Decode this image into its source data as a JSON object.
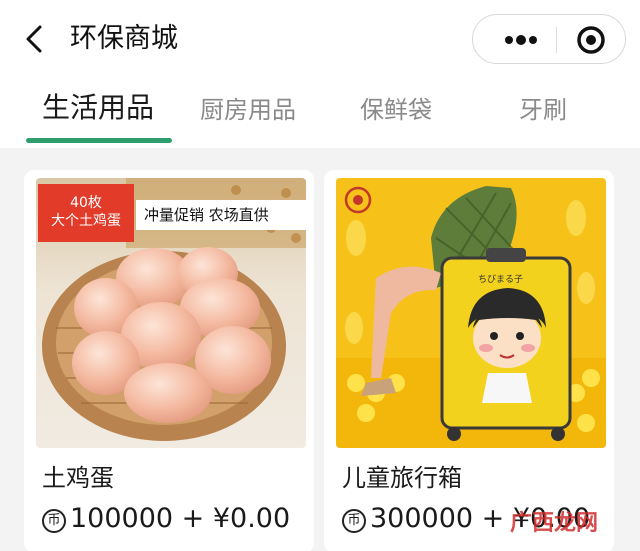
{
  "header": {
    "title": "环保商城"
  },
  "tabs": [
    {
      "label": "生活用品",
      "active": true
    },
    {
      "label": "厨房用品",
      "active": false
    },
    {
      "label": "保鲜袋",
      "active": false
    },
    {
      "label": "牙刷",
      "active": false
    }
  ],
  "products": [
    {
      "name": "土鸡蛋",
      "coin_symbol": "币",
      "price_text": "100000 + ¥0.00",
      "badge_line1": "40枚",
      "badge_line2": "大个土鸡蛋",
      "slogan": "冲量促销  农场直供"
    },
    {
      "name": "儿童旅行箱",
      "coin_symbol": "币",
      "price_text": "300000 + ¥0.00"
    }
  ],
  "watermark": "广西龙网",
  "colors": {
    "accent": "#2e9e6e",
    "badge": "#e23b2a",
    "suitcase": "#f2d21c"
  }
}
